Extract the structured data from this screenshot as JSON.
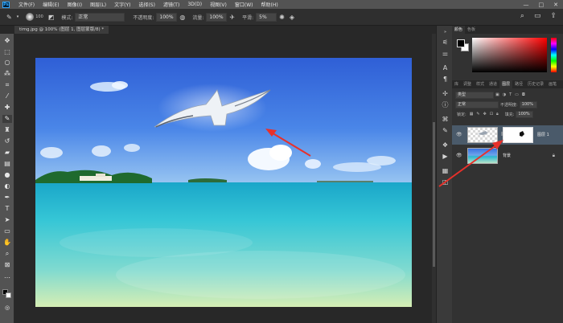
{
  "menubar": {
    "items": [
      "文件(F)",
      "编辑(E)",
      "图像(I)",
      "图层(L)",
      "文字(Y)",
      "选择(S)",
      "滤镜(T)",
      "3D(D)",
      "视图(V)",
      "窗口(W)",
      "帮助(H)"
    ],
    "window_controls": [
      "—",
      "□",
      "✕"
    ]
  },
  "options": {
    "brush_size": "100",
    "mode_label": "模式:",
    "mode_value": "正常",
    "opacity_label": "不透明度:",
    "opacity_value": "100%",
    "flow_label": "流量:",
    "flow_value": "100%",
    "smooth_label": "平滑:",
    "smooth_value": "5%"
  },
  "document": {
    "tab_title": "timg.jpg @ 100% (图层 1, 图层蒙版/8) *"
  },
  "tools": {
    "icon_names": [
      "move-icon",
      "marquee-icon",
      "lasso-icon",
      "magic-wand-icon",
      "crop-icon",
      "eyedropper-icon",
      "healing-icon",
      "brush-icon",
      "stamp-icon",
      "history-brush-icon",
      "eraser-icon",
      "gradient-icon",
      "blur-icon",
      "dodge-icon",
      "pen-icon",
      "type-icon",
      "path-select-icon",
      "shape-icon",
      "hand-icon",
      "zoom-icon",
      "more-icon"
    ]
  },
  "panels": {
    "color_tabs": [
      "颜色",
      "色板"
    ],
    "layer_tabs": [
      "库",
      "调整",
      "样式",
      "通道",
      "图层",
      "路径",
      "历史记录",
      "画笔"
    ],
    "filter_kind": "类型",
    "blend_mode": "正常",
    "opacity_label": "不透明度:",
    "opacity_value": "100%",
    "lock_label": "锁定:",
    "fill_label": "填充:",
    "fill_value": "100%",
    "layers": [
      {
        "name": "图层 1",
        "active": true
      },
      {
        "name": "背景",
        "active": false
      }
    ]
  },
  "colors": {
    "foreground": "#000000",
    "background": "#ffffff",
    "annotation_arrow": "#e8302a"
  }
}
